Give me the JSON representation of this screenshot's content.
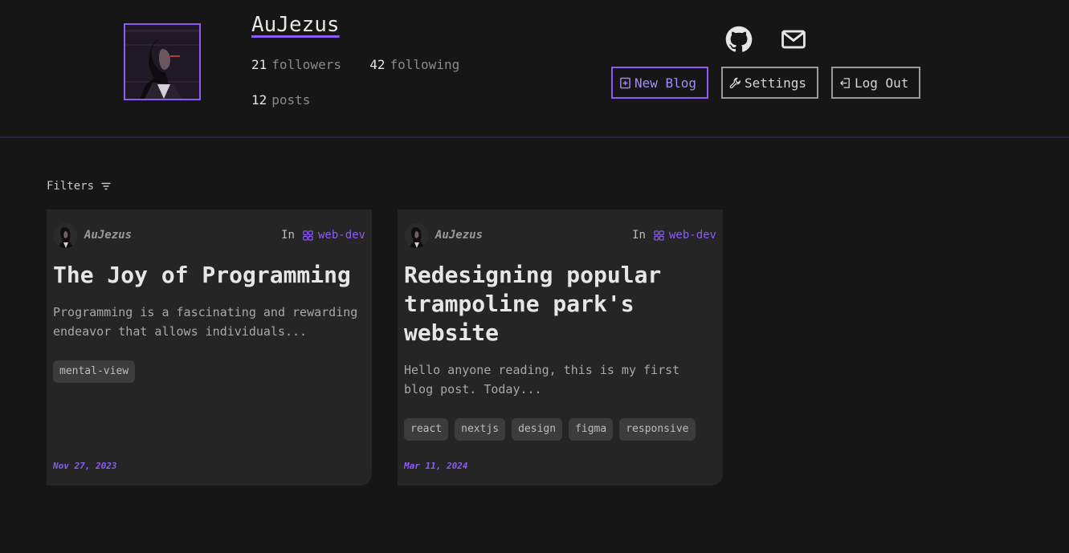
{
  "profile": {
    "username": "AuJezus",
    "followers_count": "21",
    "followers_label": "followers",
    "following_count": "42",
    "following_label": "following",
    "posts_count": "12",
    "posts_label": "posts"
  },
  "social": {
    "github_icon": "github-icon",
    "email_icon": "mail-icon"
  },
  "actions": {
    "new_blog": "New Blog",
    "settings": "Settings",
    "logout": "Log Out"
  },
  "filters": {
    "label": "Filters"
  },
  "posts": [
    {
      "author": "AuJezus",
      "in_label": "In",
      "category": "web-dev",
      "title": "The Joy of Programming",
      "excerpt": "Programming is a fascinating and rewarding endeavor that allows individuals...",
      "tags": [
        "mental-view"
      ],
      "date": "Nov 27, 2023"
    },
    {
      "author": "AuJezus",
      "in_label": "In",
      "category": "web-dev",
      "title": "Redesigning popular trampoline park's website",
      "excerpt": "Hello anyone reading, this is my first blog post. Today...",
      "tags": [
        "react",
        "nextjs",
        "design",
        "figma",
        "responsive"
      ],
      "date": "Mar 11, 2024"
    }
  ],
  "colors": {
    "background": "#161616",
    "card": "#252525",
    "accent": "#8b5cf6",
    "tag_bg": "#3c3c3c"
  }
}
